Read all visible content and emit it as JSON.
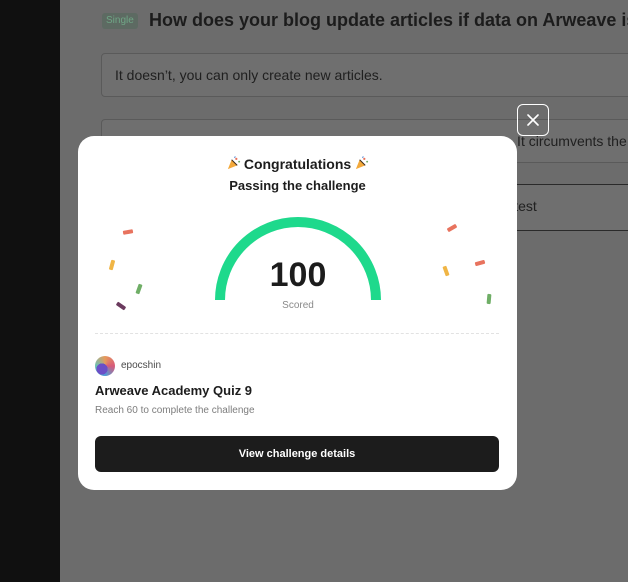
{
  "background": {
    "question": {
      "tag": "Single",
      "title": "How does your blog update articles if data on Arweave is"
    },
    "options": [
      "It doesn’t, you can only create new articles.",
      "It uses the UPDATE command to replace old data with new one. It circumvents the immutab",
      "It stores new versions of articles and the app only displays the latest"
    ]
  },
  "modal": {
    "close_icon": "close-icon",
    "congrats_text": "Congratulations",
    "party_icon": "party-popper-icon",
    "subtitle": "Passing the challenge",
    "score": {
      "value": "100",
      "label": "Scored",
      "progress_fraction": 1.0,
      "color": "#1ed98c"
    },
    "user": {
      "name": "epocshin"
    },
    "quiz": {
      "title": "Arweave Academy Quiz 9",
      "description": "Reach 60 to complete the challenge"
    },
    "button_label": "View challenge details"
  },
  "colors": {
    "overlay": "#6c6c6c",
    "modal_bg": "#ffffff",
    "button_bg": "#1c1c1c",
    "gauge": "#1ed98c",
    "confetti": [
      "#e8735e",
      "#f0b545",
      "#6fae66",
      "#6b3a5e"
    ]
  }
}
